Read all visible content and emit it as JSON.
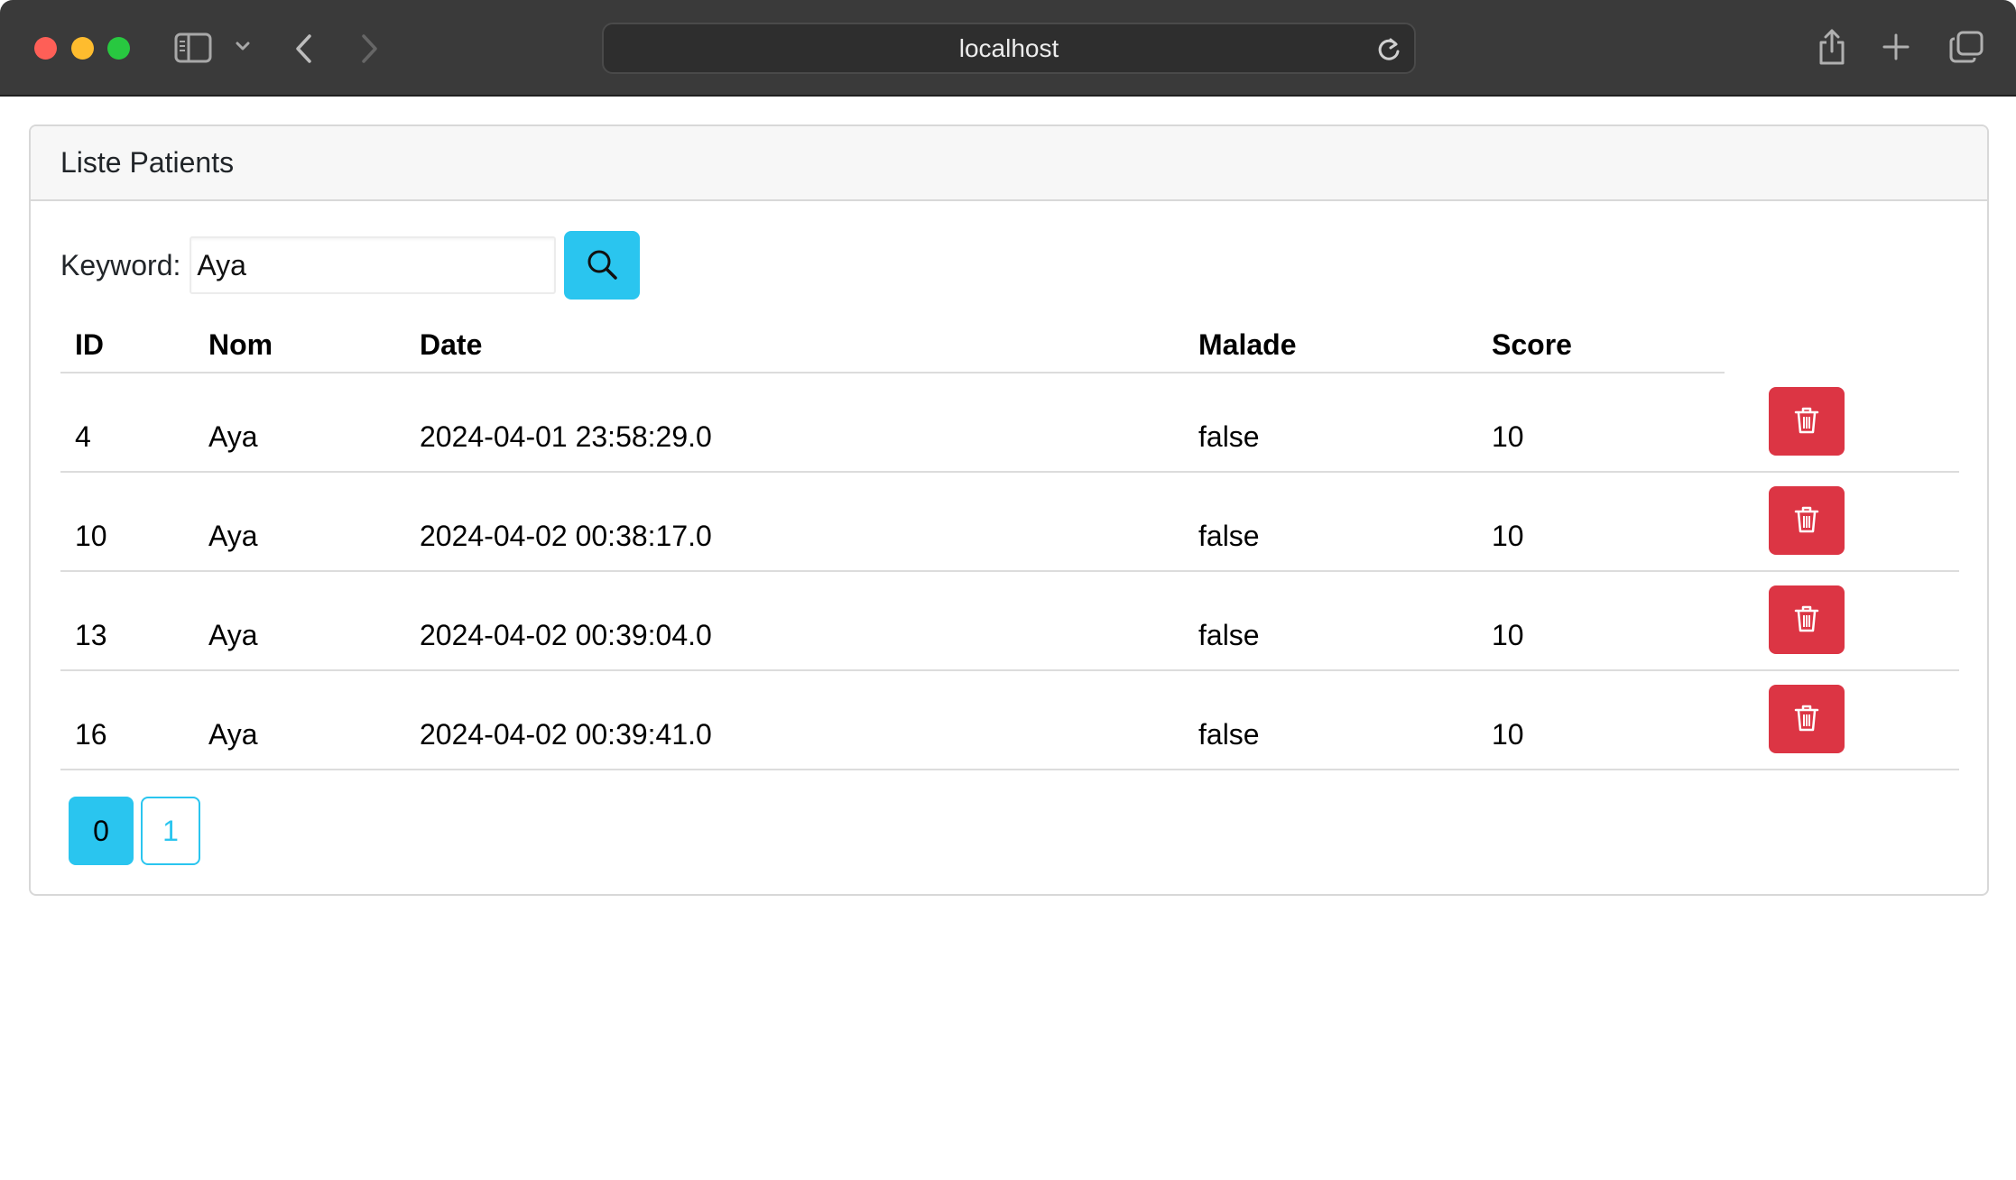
{
  "browser": {
    "url": "localhost"
  },
  "card": {
    "title": "Liste Patients"
  },
  "search": {
    "label": "Keyword:",
    "value": "Aya"
  },
  "table": {
    "headers": [
      "ID",
      "Nom",
      "Date",
      "Malade",
      "Score"
    ],
    "rows": [
      {
        "id": "4",
        "nom": "Aya",
        "date": "2024-04-01 23:58:29.0",
        "malade": "false",
        "score": "10"
      },
      {
        "id": "10",
        "nom": "Aya",
        "date": "2024-04-02 00:38:17.0",
        "malade": "false",
        "score": "10"
      },
      {
        "id": "13",
        "nom": "Aya",
        "date": "2024-04-02 00:39:04.0",
        "malade": "false",
        "score": "10"
      },
      {
        "id": "16",
        "nom": "Aya",
        "date": "2024-04-02 00:39:41.0",
        "malade": "false",
        "score": "10"
      }
    ]
  },
  "pagination": {
    "pages": [
      "0",
      "1"
    ],
    "current": "0"
  },
  "colors": {
    "primary": "#2ac5ef",
    "danger": "#dc3544"
  }
}
